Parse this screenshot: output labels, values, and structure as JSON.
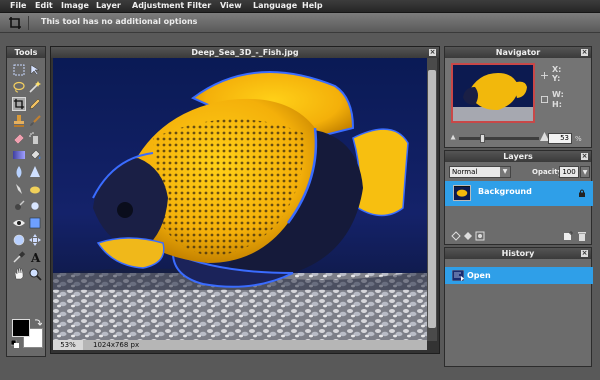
{
  "menu": [
    "File",
    "Edit",
    "Image",
    "Layer",
    "Adjustment",
    "Filter",
    "View",
    "Language",
    "Help"
  ],
  "options_bar": {
    "message": "This tool has no additional options",
    "tool_icon": "crop-icon"
  },
  "tools_panel": {
    "title": "Tools",
    "tools": [
      "marquee-icon",
      "move-icon",
      "lasso-icon",
      "magic-wand-icon",
      "crop-icon",
      "pencil-icon",
      "stamp-icon",
      "brush-icon",
      "eraser-icon",
      "spray-icon",
      "gradient-icon",
      "paint-bucket-icon",
      "blur-icon",
      "sharpen-icon",
      "smudge-icon",
      "sponge-icon",
      "eye-icon",
      "rectangle-icon",
      "burn-icon",
      "dodge-icon",
      "circle-select-icon",
      "move-arrows-icon",
      "eyedropper-icon",
      "text-icon",
      "hand-icon",
      "zoom-icon"
    ],
    "selected_tool": "crop-icon",
    "foreground_color": "#000000",
    "background_color": "#ffffff"
  },
  "document": {
    "title": "Deep_Sea_3D_-_Fish.jpg",
    "zoom": "53%",
    "dimensions": "1024x768 px"
  },
  "navigator": {
    "title": "Navigator",
    "x_label": "X:",
    "y_label": "Y:",
    "w_label": "W:",
    "h_label": "H:",
    "zoom_value": "53",
    "zoom_unit": "%",
    "slider_level": 0.28
  },
  "layers": {
    "title": "Layers",
    "blend_mode": "Normal",
    "opacity_label": "Opacity:",
    "opacity_value": "100",
    "items": [
      {
        "name": "Background",
        "locked": true
      }
    ]
  },
  "history": {
    "title": "History",
    "items": [
      {
        "label": "Open"
      }
    ]
  }
}
